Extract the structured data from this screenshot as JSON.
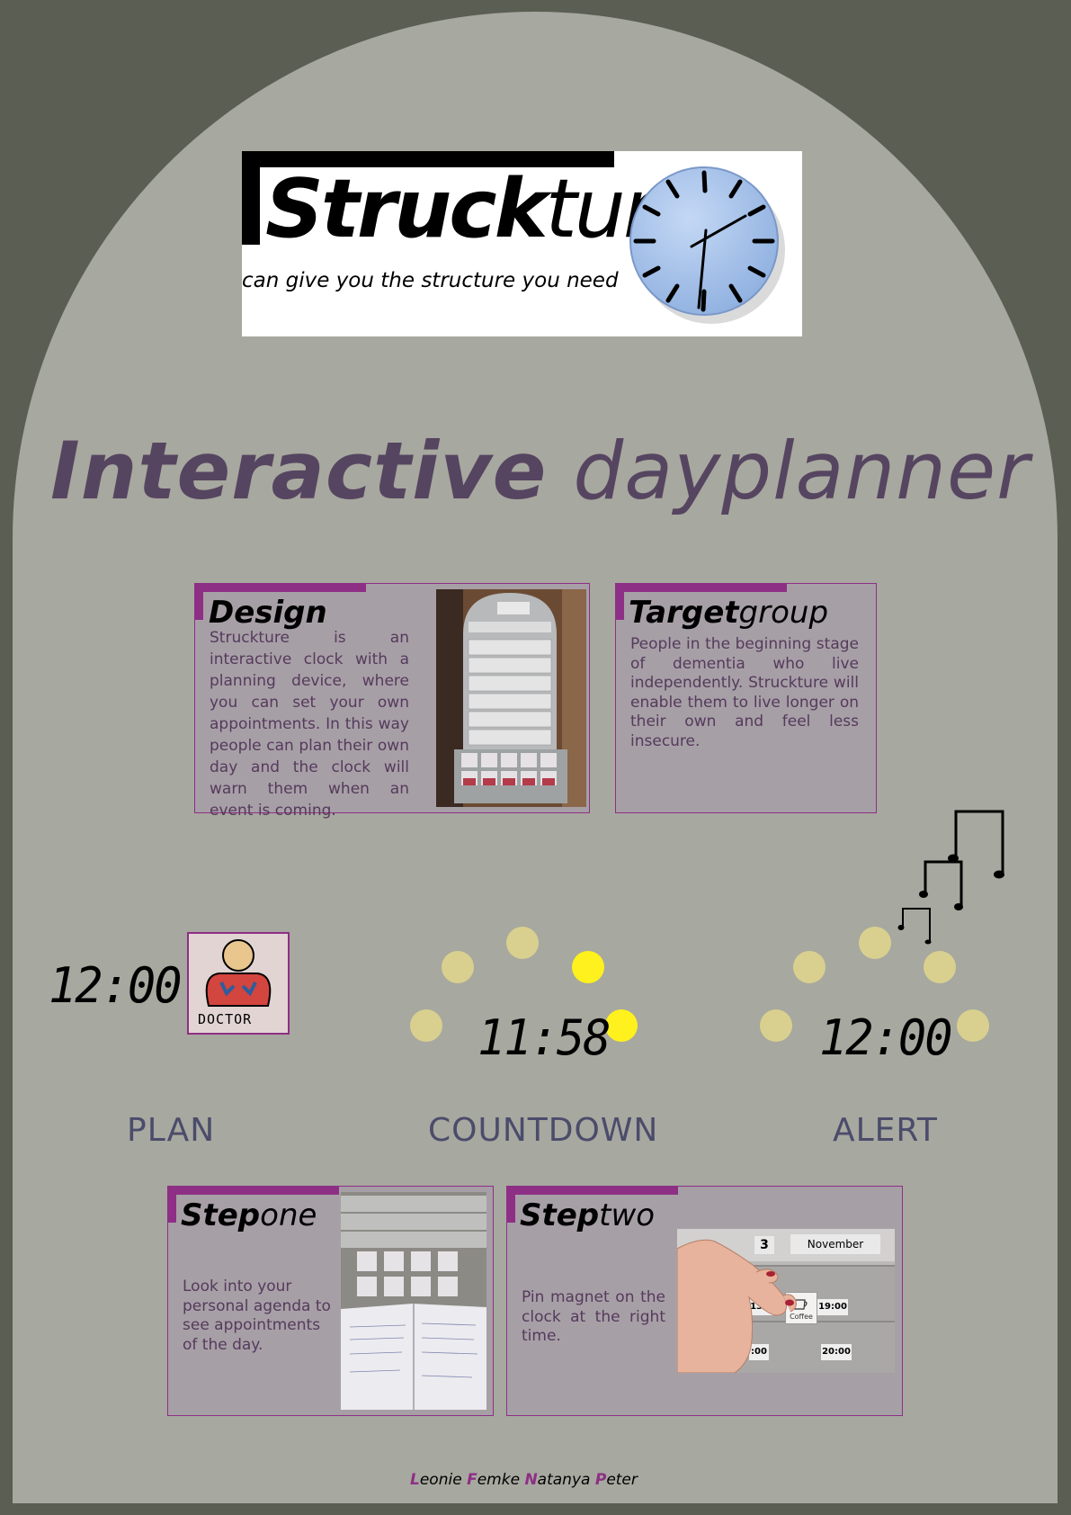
{
  "logo": {
    "word_bold": "Struck",
    "word_light": "ture",
    "tagline": "can give you the structure you need",
    "icon": "clock-icon"
  },
  "title": {
    "bold": "Interactive",
    "light": "dayplanner"
  },
  "design": {
    "title": "Design",
    "text": "Struckture is an interactive clock with a planning device, where you can set your own appointments. In this way people can plan their own day and the clock will warn them when an event is coming.",
    "photo": "dayplanner-device-photo"
  },
  "target": {
    "title_bold": "Target",
    "title_light": "group",
    "text": "People in the beginning stage of dementia who live independently. Struckture will enable them to live longer on their own and feel less insecure."
  },
  "stages": {
    "plan": {
      "time": "12:00",
      "card_text": "DOCTOR",
      "label": "PLAN"
    },
    "countdown": {
      "time": "11:58",
      "label": "COUNTDOWN"
    },
    "alert": {
      "time": "12:00",
      "label": "ALERT"
    }
  },
  "step_one": {
    "title_bold": "Step",
    "title_light": "one",
    "text": "Look into your personal agenda to see appointments of the day.",
    "photo": "agenda-photo"
  },
  "step_two": {
    "title_bold": "Step",
    "title_light": "two",
    "text": "Pin magnet on the clock at the right time.",
    "photo": "magnet-photo",
    "photo_day": "3",
    "photo_month": "November",
    "photo_t1": "13:00",
    "photo_t2": "19:00",
    "photo_t3": "20:00",
    "photo_t4": ":00",
    "photo_card": "Coffee"
  },
  "credits": {
    "n1_initial": "L",
    "n1_rest": "eonie ",
    "n2_initial": "F",
    "n2_rest": "emke ",
    "n3_initial": "N",
    "n3_rest": "atanya ",
    "n4_initial": "P",
    "n4_rest": "eter"
  },
  "colors": {
    "frame": "#5b5e53",
    "background": "#a7a89f",
    "accent": "#8e2f86",
    "title": "#564560",
    "dot_off": "#d9d08f",
    "dot_on": "#fff11d"
  }
}
